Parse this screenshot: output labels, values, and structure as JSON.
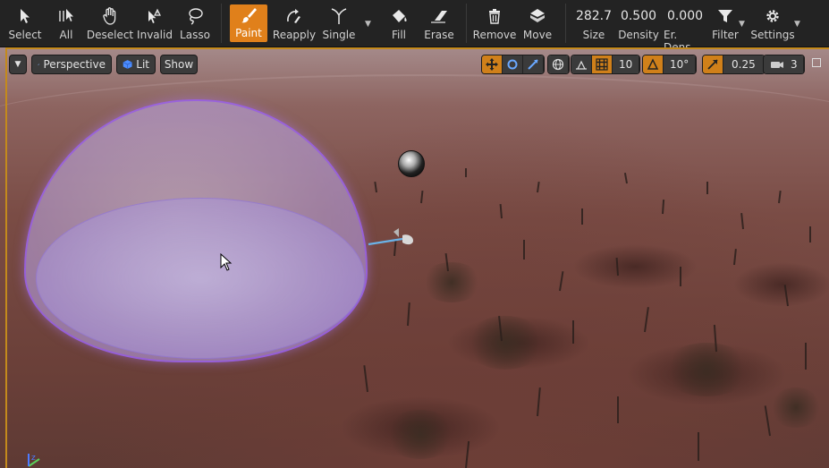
{
  "toolbar": {
    "tools": [
      {
        "label": "Select",
        "icon": "arrow-cursor-icon"
      },
      {
        "label": "All",
        "icon": "select-all-icon"
      },
      {
        "label": "Deselect",
        "icon": "hand-icon"
      },
      {
        "label": "Invalid",
        "icon": "invalid-cursor-icon"
      },
      {
        "label": "Lasso",
        "icon": "lasso-icon"
      },
      {
        "label": "Paint",
        "icon": "brush-icon",
        "active": true
      },
      {
        "label": "Reapply",
        "icon": "reapply-icon"
      },
      {
        "label": "Single",
        "icon": "single-icon"
      },
      {
        "label": "Fill",
        "icon": "bucket-icon"
      },
      {
        "label": "Erase",
        "icon": "eraser-icon"
      },
      {
        "label": "Remove",
        "icon": "trash-icon"
      },
      {
        "label": "Move",
        "icon": "move-icon"
      },
      {
        "label": "Filter",
        "icon": "funnel-icon"
      },
      {
        "label": "Settings",
        "icon": "gear-icon"
      }
    ],
    "values": {
      "size": {
        "value": "282.7",
        "label": "Size"
      },
      "density": {
        "value": "0.500",
        "label": "Density"
      },
      "erase_density": {
        "value": "0.000",
        "label": "Er. Dens."
      }
    }
  },
  "viewport": {
    "perspective_label": "Perspective",
    "lit_label": "Lit",
    "show_label": "Show",
    "grid_snap_value": "10",
    "rotation_snap_value": "10°",
    "scale_snap_value": "0.25",
    "camera_speed_value": "3"
  },
  "colors": {
    "accent": "#e0801b",
    "brush_dome": "#b79ae6",
    "ground": "#7a4c45"
  }
}
